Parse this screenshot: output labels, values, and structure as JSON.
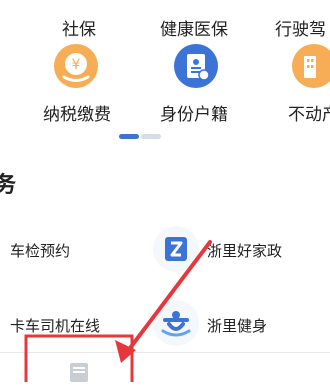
{
  "top_row": [
    {
      "label": "社保"
    },
    {
      "label": "健康医保"
    },
    {
      "label": "行驶驾"
    }
  ],
  "second_row": [
    {
      "label": "纳税缴费",
      "icon": "tax-yuan-icon"
    },
    {
      "label": "身份户籍",
      "icon": "id-card-icon"
    },
    {
      "label": "不动产",
      "icon": "property-icon"
    }
  ],
  "section": {
    "title_fragment": "务"
  },
  "services": [
    {
      "label": "车检预约"
    },
    {
      "label": "浙里好家政",
      "icon": "zheli-housekeeping-icon"
    },
    {
      "label": "卡车司机在线"
    },
    {
      "label": "浙里健身",
      "icon": "fitness-icon"
    }
  ],
  "colors": {
    "accent": "#3b73d6",
    "orange": "#f6ad55",
    "annotation_red": "#e6383c"
  }
}
